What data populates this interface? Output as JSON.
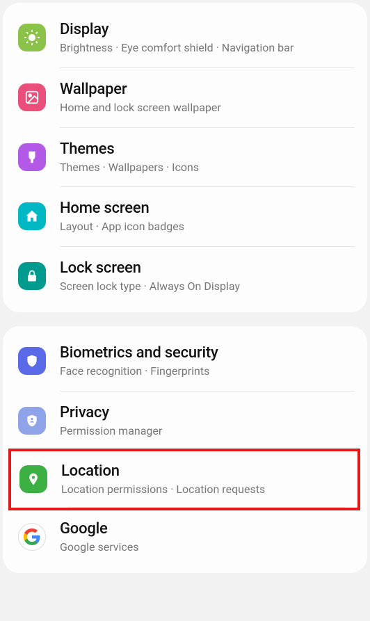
{
  "groups": [
    {
      "items": [
        {
          "id": "display",
          "title": "Display",
          "sub": "Brightness  ·  Eye comfort shield  ·  Navigation bar",
          "icon": "sun-icon",
          "color": "#8bc34a"
        },
        {
          "id": "wallpaper",
          "title": "Wallpaper",
          "sub": "Home and lock screen wallpaper",
          "icon": "picture-icon",
          "color": "#e94f7a"
        },
        {
          "id": "themes",
          "title": "Themes",
          "sub": "Themes  ·  Wallpapers  ·  Icons",
          "icon": "brush-icon",
          "color": "#b25ae7"
        },
        {
          "id": "home-screen",
          "title": "Home screen",
          "sub": "Layout  ·  App icon badges",
          "icon": "home-icon",
          "color": "#00b8c4"
        },
        {
          "id": "lock-screen",
          "title": "Lock screen",
          "sub": "Screen lock type  ·  Always On Display",
          "icon": "lock-icon",
          "color": "#009b8e"
        }
      ]
    },
    {
      "items": [
        {
          "id": "biometrics",
          "title": "Biometrics and security",
          "sub": "Face recognition  ·  Fingerprints",
          "icon": "shield-icon",
          "color": "#5969e8"
        },
        {
          "id": "privacy",
          "title": "Privacy",
          "sub": "Permission manager",
          "icon": "badge-icon",
          "color": "#8ea3e8"
        },
        {
          "id": "location",
          "title": "Location",
          "sub": "Location permissions  ·  Location requests",
          "icon": "pin-icon",
          "color": "#3cb043",
          "highlight": true
        },
        {
          "id": "google",
          "title": "Google",
          "sub": "Google services",
          "icon": "google-icon",
          "color": "#ffffff"
        }
      ]
    }
  ]
}
